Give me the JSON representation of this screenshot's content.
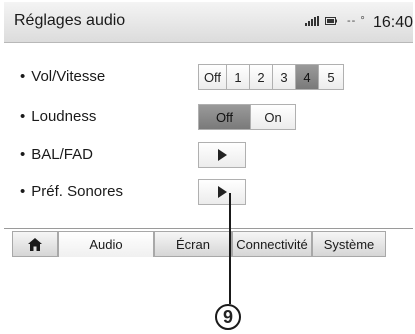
{
  "header": {
    "title": "Réglages audio",
    "temp": "-- °",
    "time": "16:40",
    "icons": [
      "signal-icon",
      "battery-icon"
    ]
  },
  "settings": [
    {
      "label": "Vol/Vitesse",
      "type": "segmented",
      "options": [
        "Off",
        "1",
        "2",
        "3",
        "4",
        "5"
      ],
      "selected": "4"
    },
    {
      "label": "Loudness",
      "type": "segmented",
      "options": [
        "Off",
        "On"
      ],
      "selected": "Off"
    },
    {
      "label": "BAL/FAD",
      "type": "play-button",
      "icon": "play-icon"
    },
    {
      "label": "Préf. Sonores",
      "type": "play-button",
      "icon": "play-icon"
    }
  ],
  "tabs": [
    {
      "label": "",
      "icon": "home-icon"
    },
    {
      "label": "Audio",
      "active": true
    },
    {
      "label": "Écran"
    },
    {
      "label": "Connectivité"
    },
    {
      "label": "Système"
    }
  ],
  "callout": {
    "number": "9"
  },
  "colors": {
    "active_segment": "#8a8a8a",
    "header_bg": "#e6e6e6",
    "text": "#1a1a1a"
  }
}
